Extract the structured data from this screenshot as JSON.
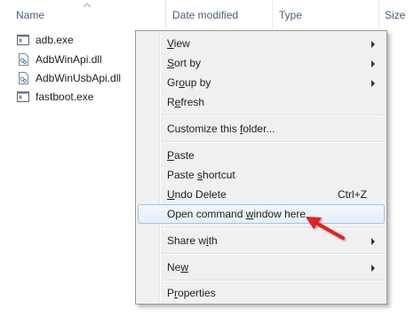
{
  "columns": {
    "name": "Name",
    "date_modified": "Date modified",
    "type": "Type",
    "size": "Size"
  },
  "files": [
    {
      "name": "adb.exe",
      "icon": "exe-icon"
    },
    {
      "name": "AdbWinApi.dll",
      "icon": "dll-icon"
    },
    {
      "name": "AdbWinUsbApi.dll",
      "icon": "dll-icon"
    },
    {
      "name": "fastboot.exe",
      "icon": "exe-icon"
    }
  ],
  "menu": {
    "view": {
      "pre": "",
      "key": "V",
      "post": "iew"
    },
    "sort_by": {
      "pre": "",
      "key": "S",
      "post": "ort by"
    },
    "group_by": {
      "pre": "Gr",
      "key": "o",
      "post": "up by"
    },
    "refresh": {
      "pre": "R",
      "key": "e",
      "post": "fresh"
    },
    "customize": {
      "pre": "Customize this ",
      "key": "f",
      "post": "older..."
    },
    "paste": {
      "pre": "",
      "key": "P",
      "post": "aste"
    },
    "paste_shortcut": {
      "pre": "Paste ",
      "key": "s",
      "post": "hortcut"
    },
    "undo_delete": {
      "pre": "",
      "key": "U",
      "post": "ndo Delete",
      "shortcut": "Ctrl+Z"
    },
    "open_cmd": {
      "pre": "Open command ",
      "key": "w",
      "post": "indow here"
    },
    "share_with": {
      "pre": "Share w",
      "key": "i",
      "post": "th"
    },
    "new": {
      "pre": "Ne",
      "key": "w",
      "post": ""
    },
    "properties": {
      "pre": "P",
      "key": "r",
      "post": "operties"
    }
  },
  "colors": {
    "header_text": "#4c607a",
    "highlight_border": "#a8c2e3",
    "arrow_red": "#e02020"
  }
}
